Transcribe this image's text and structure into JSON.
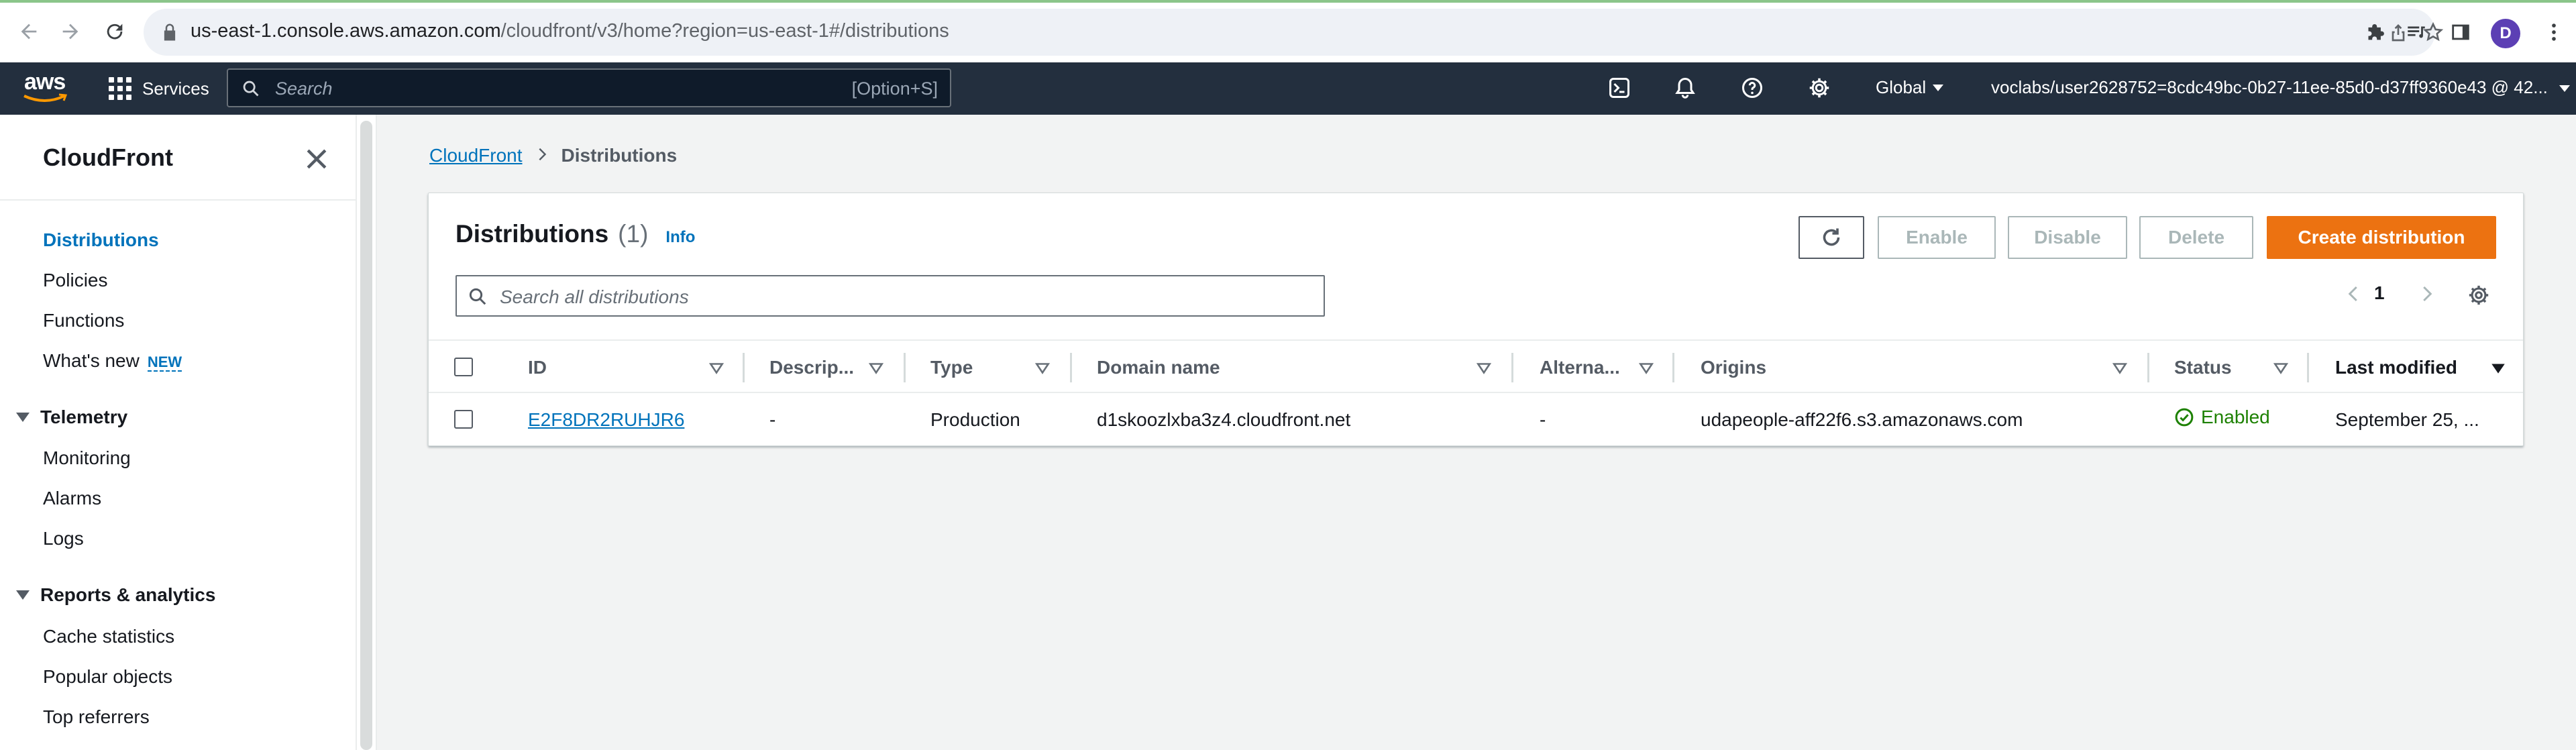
{
  "browser": {
    "url_host": "us-east-1.console.aws.amazon.com",
    "url_path": "/cloudfront/v3/home?region=us-east-1#/distributions",
    "profile_initial": "D"
  },
  "aws_nav": {
    "logo_text": "aws",
    "services_label": "Services",
    "search_placeholder": "Search",
    "search_shortcut": "[Option+S]",
    "region_label": "Global",
    "account_label": "voclabs/user2628752=8cdc49bc-0b27-11ee-85d0-d37ff9360e43 @ 42..."
  },
  "sidebar": {
    "title": "CloudFront",
    "items": [
      {
        "label": "Distributions"
      },
      {
        "label": "Policies"
      },
      {
        "label": "Functions"
      },
      {
        "label": "What's new",
        "badge": "NEW"
      }
    ],
    "sections": [
      {
        "title": "Telemetry",
        "items": [
          {
            "label": "Monitoring"
          },
          {
            "label": "Alarms"
          },
          {
            "label": "Logs"
          }
        ]
      },
      {
        "title": "Reports & analytics",
        "items": [
          {
            "label": "Cache statistics"
          },
          {
            "label": "Popular objects"
          },
          {
            "label": "Top referrers"
          }
        ]
      }
    ]
  },
  "breadcrumb": {
    "root": "CloudFront",
    "current": "Distributions"
  },
  "panel": {
    "title": "Distributions",
    "count": "(1)",
    "info_label": "Info",
    "buttons": {
      "enable": "Enable",
      "disable": "Disable",
      "delete": "Delete",
      "create": "Create distribution"
    },
    "filter_placeholder": "Search all distributions",
    "page": "1"
  },
  "table": {
    "columns": [
      "ID",
      "Descrip...",
      "Type",
      "Domain name",
      "Alterna...",
      "Origins",
      "Status",
      "Last modified"
    ],
    "rows": [
      {
        "id": "E2F8DR2RUHJR6",
        "description": "-",
        "type": "Production",
        "domain": "d1skoozlxba3z4.cloudfront.net",
        "alternate": "-",
        "origins": "udapeople-aff22f6.s3.amazonaws.com",
        "status": "Enabled",
        "last_modified": "September 25, ..."
      }
    ]
  },
  "colors": {
    "aws_nav_bg": "#232f3e",
    "link": "#0073bb",
    "primary_button": "#ec7211",
    "success": "#1d8102"
  }
}
